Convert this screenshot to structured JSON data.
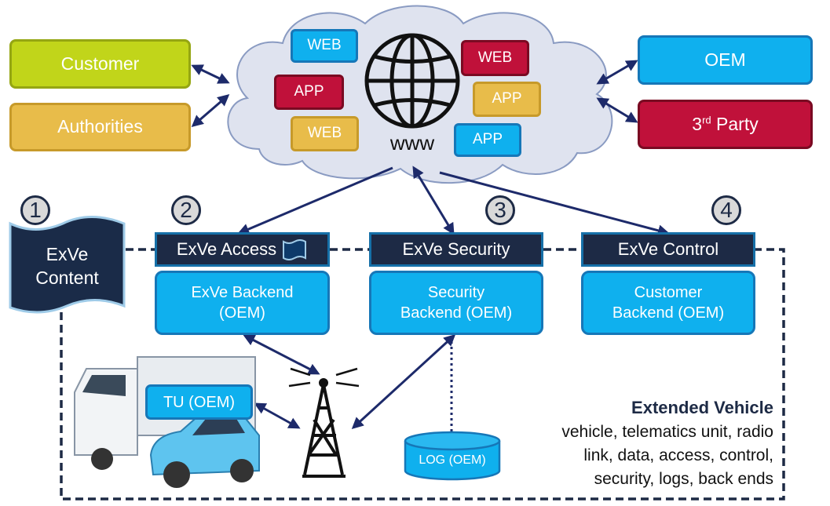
{
  "colors": {
    "navy": "#1d2a45",
    "blue": "#0fb0ee",
    "lime": "#c1d51a",
    "gold": "#e8bc4a",
    "crimson": "#c0113a",
    "cloud": "#dfe3ef"
  },
  "actors": {
    "customer": "Customer",
    "authorities": "Authorities",
    "oem": "OEM",
    "third_party_sup": "rd",
    "third_party_num": "3",
    "third_party_rest": " Party"
  },
  "cloud": {
    "items": [
      "WEB",
      "APP",
      "WEB",
      "WEB",
      "APP",
      "APP"
    ],
    "www": "www",
    "icon": "globe-icon"
  },
  "numbers": [
    "1",
    "2",
    "3",
    "4"
  ],
  "content": {
    "line1": "ExVe",
    "line2": "Content"
  },
  "headers": [
    "ExVe Access",
    "ExVe Security",
    "ExVe Control"
  ],
  "backends": [
    {
      "line1": "ExVe Backend",
      "line2": "(OEM)"
    },
    {
      "line1": "Security",
      "line2": "Backend (OEM)"
    },
    {
      "line1": "Customer",
      "line2": "Backend (OEM)"
    }
  ],
  "tu": "TU (OEM)",
  "log": "LOG (OEM)",
  "extended": {
    "title": "Extended Vehicle",
    "lines": [
      "vehicle, telematics unit, radio",
      "link, data, access, control,",
      "security, logs, back ends"
    ]
  }
}
